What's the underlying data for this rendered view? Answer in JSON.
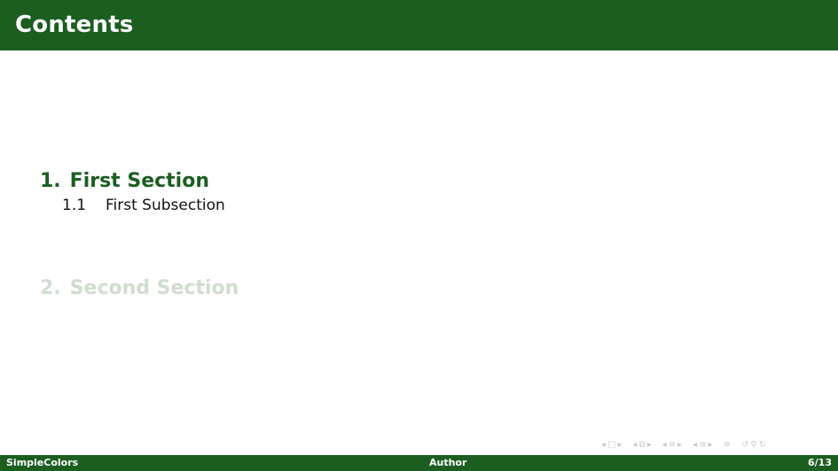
{
  "header": {
    "title": "Contents"
  },
  "toc": {
    "sections": [
      {
        "number": "1.",
        "title": "First Section",
        "subsections": [
          {
            "number": "1.1",
            "title": "First Subsection"
          }
        ]
      },
      {
        "number": "2.",
        "title": "Second Section",
        "subsections": []
      }
    ]
  },
  "nav_icons": [
    "arrow-left-icon",
    "frame-icon",
    "arrow-right-icon",
    "arrow-left-icon",
    "subsection-frame-icon",
    "arrow-right-icon",
    "arrow-left-icon",
    "section-icon",
    "arrow-right-icon",
    "arrow-left-icon",
    "subsection-icon",
    "arrow-right-icon",
    "align-icon",
    "back-icon",
    "search-icon",
    "forward-icon"
  ],
  "footer": {
    "left": "SimpleColors",
    "center": "Author",
    "right": "6/13"
  },
  "colors": {
    "primary": "#1b5e20",
    "inactive": "#cfdccf",
    "text": "#111111",
    "nav": "#c9c9c9"
  }
}
